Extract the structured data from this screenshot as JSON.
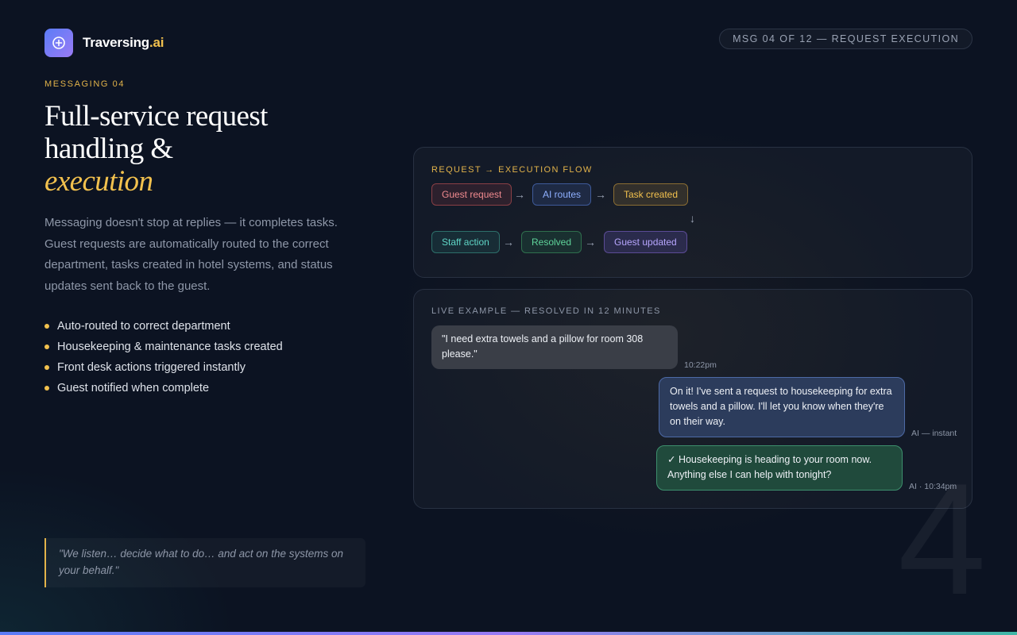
{
  "brand": {
    "name": "Traversing",
    "suffix": ".ai",
    "colors": {
      "accent": "#f2c14e",
      "logo_gradient_start": "#5b7cf7",
      "logo_gradient_end": "#9a7bf5"
    },
    "icon": "plus-circle-icon"
  },
  "header": {
    "progress_pill": "MSG 04 OF 12 — REQUEST EXECUTION"
  },
  "hero": {
    "eyebrow": "MESSAGING 04",
    "headline_line1": "Full-service request",
    "headline_line2": "handling &",
    "headline_emphasis": "execution",
    "lead": "Messaging doesn't stop at replies — it completes tasks. Guest requests are automatically routed to the correct department, tasks created in hotel systems, and status updates sent back to the guest."
  },
  "bullets": [
    "Auto-routed to correct department",
    "Housekeeping & maintenance tasks created",
    "Front desk actions triggered instantly",
    "Guest notified when complete"
  ],
  "quote": "\"We listen… decide what to do… and act on the systems on your behalf.\"",
  "flow": {
    "title": "REQUEST → EXECUTION FLOW",
    "arrow_right": "→",
    "arrow_down": "↓",
    "steps": [
      "Guest request",
      "AI routes",
      "Task created",
      "Staff action",
      "Resolved",
      "Guest updated"
    ]
  },
  "live_example": {
    "title": "LIVE EXAMPLE — RESOLVED IN 12 MINUTES",
    "messages": [
      {
        "from": "guest",
        "text": "\"I need extra towels and a pillow for room 308 please.\"",
        "meta": "10:22pm"
      },
      {
        "from": "ai",
        "text": "On it! I've sent a request to housekeeping for extra towels and a pillow. I'll let you know when they're on their way.",
        "meta": "AI — instant"
      },
      {
        "from": "ai",
        "text": "✓ Housekeeping is heading to your room now. Anything else I can help with tonight?",
        "meta": "AI · 10:34pm"
      }
    ]
  },
  "slide_number": "4"
}
